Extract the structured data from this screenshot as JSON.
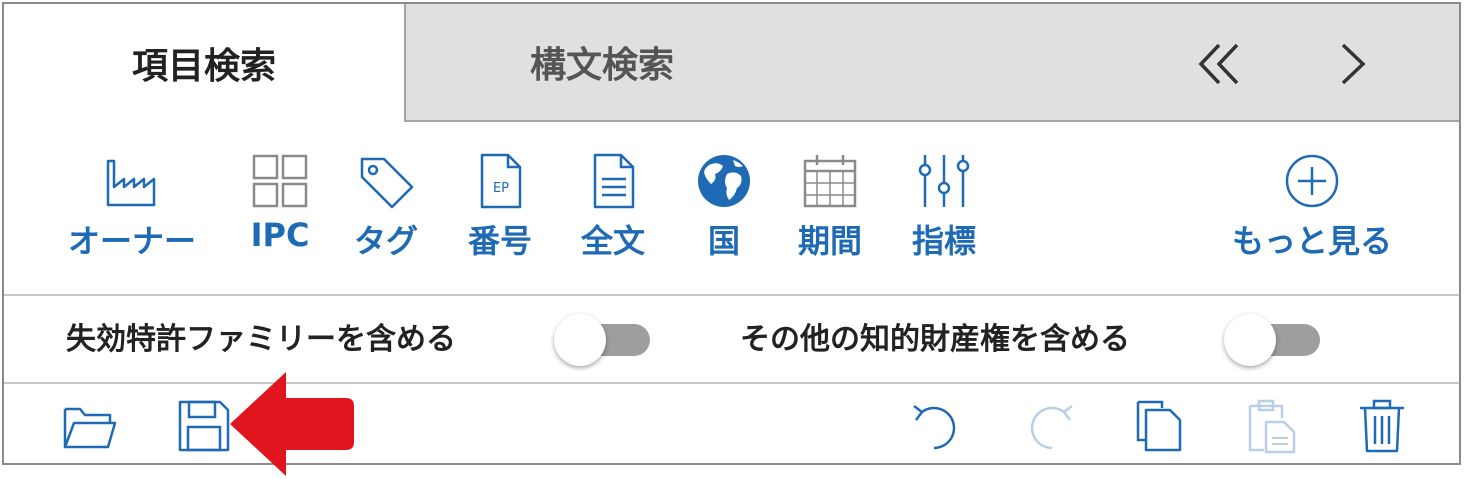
{
  "tabs": [
    {
      "label": "項目検索",
      "active": true
    },
    {
      "label": "構文検索",
      "active": false
    }
  ],
  "nav": {
    "rewind_icon": "double-chevron-left-icon",
    "next_icon": "chevron-right-icon"
  },
  "toolbar": {
    "items": [
      {
        "label": "オーナー",
        "icon": "factory-icon"
      },
      {
        "label": "IPC",
        "icon": "grid-icon"
      },
      {
        "label": "タグ",
        "icon": "tag-icon"
      },
      {
        "label": "番号",
        "icon": "ep-document-icon"
      },
      {
        "label": "全文",
        "icon": "document-icon"
      },
      {
        "label": "国",
        "icon": "globe-icon"
      },
      {
        "label": "期間",
        "icon": "calendar-icon"
      },
      {
        "label": "指標",
        "icon": "sliders-icon"
      },
      {
        "label": "もっと見る",
        "icon": "plus-circle-icon"
      }
    ],
    "ep_text": "EP"
  },
  "options": {
    "expired_family_label": "失効特許ファミリーを含める",
    "expired_family_enabled": false,
    "other_ip_label": "その他の知的財産権を含める",
    "other_ip_enabled": false
  },
  "bottom_actions": [
    "folder-open-icon",
    "save-icon",
    "undo-icon",
    "redo-icon",
    "copy-icon",
    "paste-icon",
    "trash-icon"
  ],
  "colors": {
    "accent": "#1f6ab5",
    "tab_inactive_bg": "#e0e0e0",
    "toggle_off": "#9e9e9e",
    "annotation_arrow": "#e0151e"
  }
}
